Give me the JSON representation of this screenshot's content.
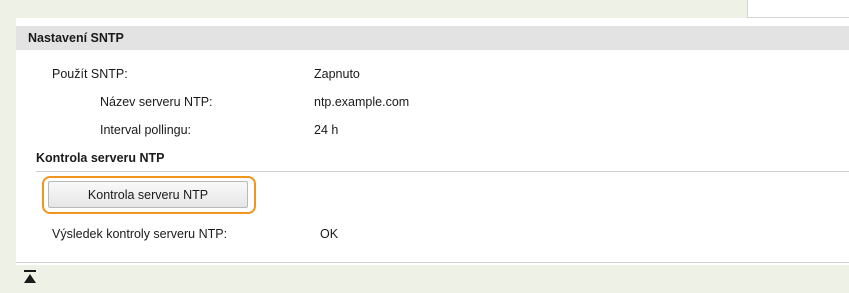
{
  "section": {
    "title": "Nastavení SNTP"
  },
  "settings": {
    "use_sntp_label": "Použít SNTP:",
    "use_sntp_value": "Zapnuto",
    "server_name_label": "Název serveru NTP:",
    "server_name_value": "ntp.example.com",
    "polling_label": "Interval pollingu:",
    "polling_value": "24 h"
  },
  "check": {
    "heading": "Kontrola serveru NTP",
    "button_label": "Kontrola serveru NTP",
    "result_label": "Výsledek kontroly serveru NTP:",
    "result_value": "OK"
  },
  "colors": {
    "highlight": "#f0961e",
    "background": "#eef1e6",
    "header": "#e3e3e3"
  },
  "icons": {
    "back_to_top": "back-to-top-icon"
  }
}
